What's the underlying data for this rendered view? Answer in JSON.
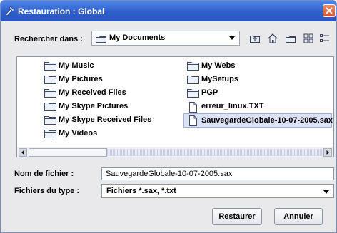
{
  "window": {
    "title": "Restauration : Global"
  },
  "look_in": {
    "label": "Rechercher dans :",
    "value": "My Documents"
  },
  "toolbar": {
    "icons": [
      "up-folder-icon",
      "home-icon",
      "new-folder-icon",
      "list-view-icon",
      "details-view-icon"
    ]
  },
  "files": [
    {
      "name": "My Music",
      "type": "folder"
    },
    {
      "name": "My Pictures",
      "type": "folder"
    },
    {
      "name": "My Received Files",
      "type": "folder"
    },
    {
      "name": "My Skype Pictures",
      "type": "folder"
    },
    {
      "name": "My Skype Received Files",
      "type": "folder"
    },
    {
      "name": "My Videos",
      "type": "folder"
    },
    {
      "name": "My Webs",
      "type": "folder"
    },
    {
      "name": "MySetups",
      "type": "folder"
    },
    {
      "name": "PGP",
      "type": "folder"
    },
    {
      "name": "erreur_linux.TXT",
      "type": "file"
    },
    {
      "name": "SauvegardeGlobale-10-07-2005.sax",
      "type": "file",
      "selected": true
    }
  ],
  "file_name": {
    "label": "Nom de fichier :",
    "value": "SauvegardeGlobale-10-07-2005.sax"
  },
  "file_type": {
    "label": "Fichiers du type :",
    "value": "Fichiers  *.sax, *.txt"
  },
  "buttons": {
    "restore": "Restaurer",
    "cancel": "Annuler"
  },
  "colors": {
    "titlebar": "#2f5fcb",
    "selection": "#dde3f7",
    "close": "#d8512b"
  }
}
